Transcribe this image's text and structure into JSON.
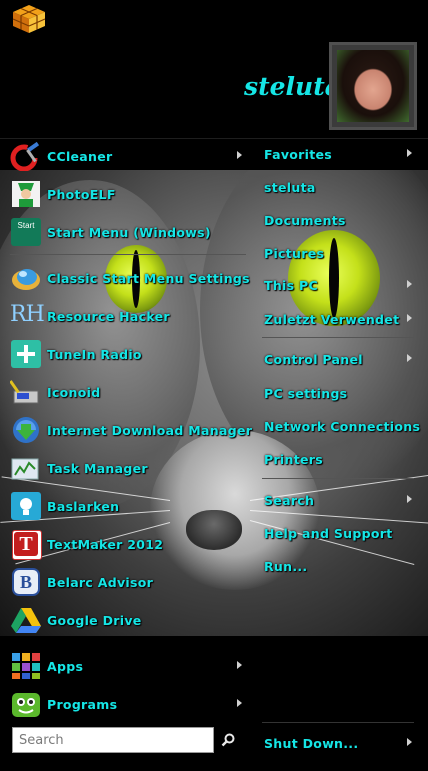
{
  "user": {
    "name": "steluta"
  },
  "left_items": [
    {
      "label": "CCleaner",
      "icon": "ccleaner-icon",
      "has_arrow": true
    },
    {
      "label": "PhotoELF",
      "icon": "photoelf-icon",
      "has_arrow": false
    },
    {
      "label": "Start Menu (Windows)",
      "icon": "start-menu-icon",
      "has_arrow": false,
      "icon_text": "Start"
    },
    {
      "label": "Classic Start Menu Settings",
      "icon": "shell-icon",
      "has_arrow": false
    },
    {
      "label": "Resource Hacker",
      "icon": "resource-hacker-icon",
      "has_arrow": false,
      "icon_text": "RH"
    },
    {
      "label": "TuneIn Radio",
      "icon": "tunein-icon",
      "has_arrow": false
    },
    {
      "label": "Iconoid",
      "icon": "iconoid-icon",
      "has_arrow": false
    },
    {
      "label": "Internet Download Manager",
      "icon": "idm-icon",
      "has_arrow": false
    },
    {
      "label": "Task Manager",
      "icon": "task-manager-icon",
      "has_arrow": false
    },
    {
      "label": "Baslarken",
      "icon": "getting-started-icon",
      "has_arrow": false
    },
    {
      "label": "TextMaker 2012",
      "icon": "textmaker-icon",
      "has_arrow": false,
      "icon_text": "T"
    },
    {
      "label": "Belarc Advisor",
      "icon": "belarc-icon",
      "has_arrow": false,
      "icon_text": "B"
    },
    {
      "label": "Google Drive",
      "icon": "google-drive-icon",
      "has_arrow": false
    }
  ],
  "bottom_left": [
    {
      "label": "Apps",
      "icon": "apps-icon",
      "has_arrow": true
    },
    {
      "label": "Programs",
      "icon": "programs-icon",
      "has_arrow": true
    }
  ],
  "right_items": [
    {
      "label": "Favorites",
      "has_arrow": true
    },
    {
      "label": "steluta",
      "has_arrow": false
    },
    {
      "label": "Documents",
      "has_arrow": false
    },
    {
      "label": "Pictures",
      "has_arrow": false
    },
    {
      "label": "This PC",
      "has_arrow": true
    },
    {
      "label": "Zuletzt Verwendet",
      "has_arrow": true
    },
    {
      "label": "Control Panel",
      "has_arrow": true
    },
    {
      "label": "PC settings",
      "has_arrow": false
    },
    {
      "label": "Network Connections",
      "has_arrow": false
    },
    {
      "label": "Printers",
      "has_arrow": false
    },
    {
      "label": "Search",
      "has_arrow": true
    },
    {
      "label": "Help and Support",
      "has_arrow": false
    },
    {
      "label": "Run...",
      "has_arrow": false
    }
  ],
  "search": {
    "placeholder": "Search",
    "value": ""
  },
  "shutdown": {
    "label": "Shut Down...",
    "has_arrow": true
  },
  "colors": {
    "text": "#15e6e6",
    "background": "#000000",
    "arrow": "#d0d0d0"
  }
}
